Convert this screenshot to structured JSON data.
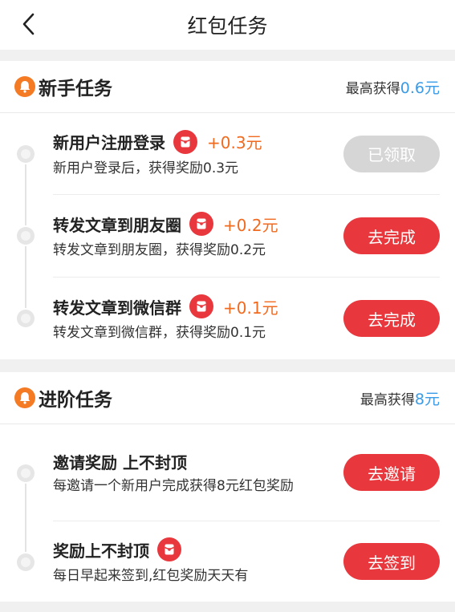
{
  "header": {
    "title": "红包任务",
    "back_icon": "chevron-left-icon"
  },
  "colors": {
    "accent_red": "#e8383d",
    "reward_orange": "#f06a1f",
    "value_blue": "#3a9be6",
    "bell_orange": "#f47a24",
    "done_grey": "#d6d6d6"
  },
  "sections": [
    {
      "title": "新手任务",
      "max_label": "最高获得",
      "max_value": "0.6元",
      "tasks": [
        {
          "name": "新用户注册登录",
          "reward": "+0.3元",
          "desc": "新用户登录后，获得奖励0.3元",
          "button": "已领取",
          "claimed": true
        },
        {
          "name": "转发文章到朋友圈",
          "reward": "+0.2元",
          "desc": "转发文章到朋友圈，获得奖励0.2元",
          "button": "去完成",
          "claimed": false
        },
        {
          "name": "转发文章到微信群",
          "reward": "+0.1元",
          "desc": "转发文章到微信群，获得奖励0.1元",
          "button": "去完成",
          "claimed": false
        }
      ]
    },
    {
      "title": "进阶任务",
      "max_label": "最高获得",
      "max_value": "8元",
      "tasks": [
        {
          "name": "邀请奖励 上不封顶",
          "desc": "每邀请一个新用户完成获得8元红包奖励",
          "button": "去邀请",
          "claimed": false
        },
        {
          "name": "奖励上不封顶",
          "desc": "每日早起来签到,红包奖励天天有",
          "button": "去签到",
          "claimed": false
        }
      ]
    }
  ]
}
